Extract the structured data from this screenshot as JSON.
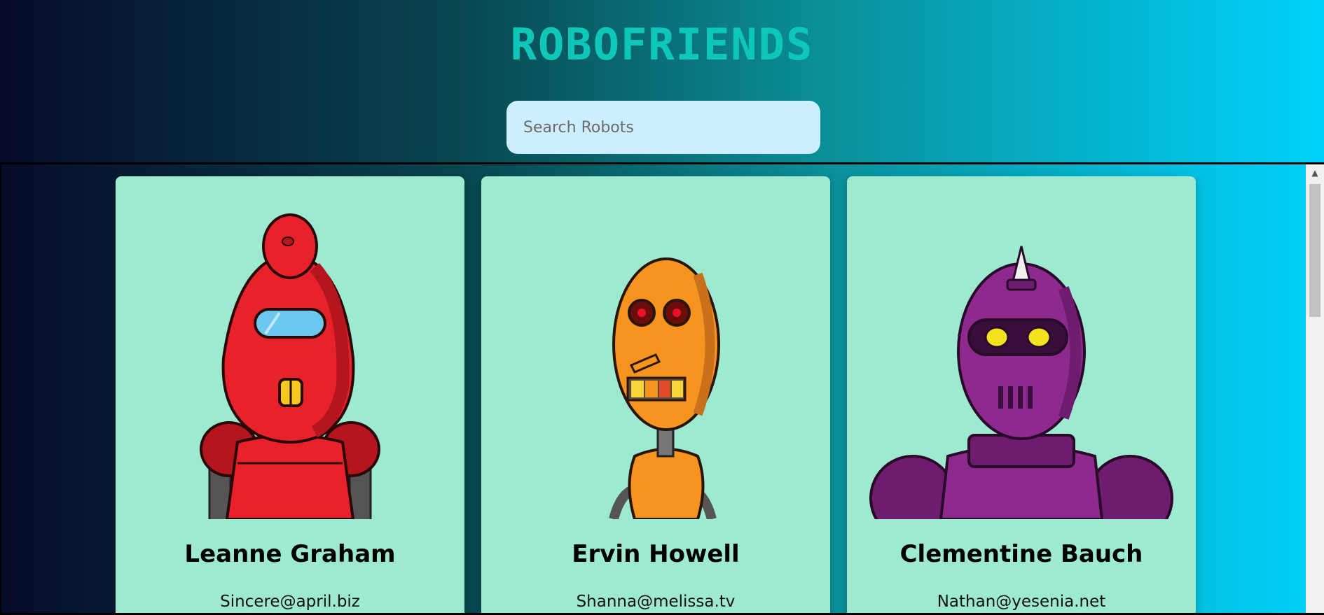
{
  "app": {
    "title": "ROBOFRIENDS"
  },
  "search": {
    "placeholder": "Search Robots",
    "value": ""
  },
  "cards": [
    {
      "name": "Leanne Graham",
      "email": "Sincere@april.biz",
      "robot_color": "#e8222a"
    },
    {
      "name": "Ervin Howell",
      "email": "Shanna@melissa.tv",
      "robot_color": "#f5941f"
    },
    {
      "name": "Clementine Bauch",
      "email": "Nathan@yesenia.net",
      "robot_color": "#8e2a8e"
    }
  ],
  "colors": {
    "card_bg": "#9eead0",
    "logo": "#0fc7b8",
    "search_bg": "#cdeefe"
  }
}
